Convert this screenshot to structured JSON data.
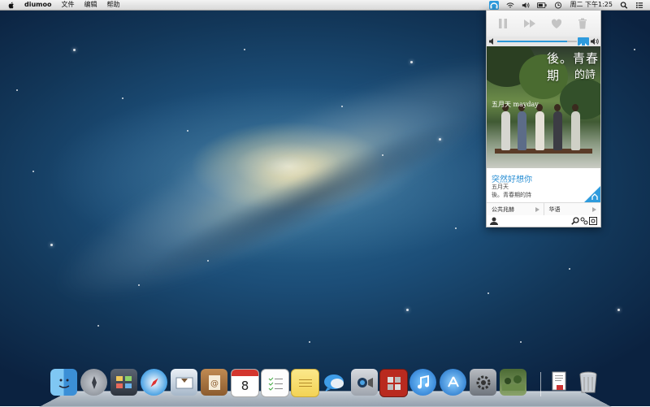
{
  "menubar": {
    "app_name": "diumoo",
    "menus": [
      "文件",
      "编辑",
      "帮助"
    ],
    "clock": "周二 下午1:25",
    "status_icons": [
      "diumoo-headphones-icon",
      "wifi-icon",
      "volume-icon",
      "battery-icon",
      "clock-icon",
      "spotlight-icon",
      "notification-list-icon"
    ]
  },
  "player": {
    "song_title": "突然好想你",
    "artist": "五月天",
    "album": "後。青春期的詩",
    "cover_art_text": [
      "後。青春期",
      "的詩",
      "五月天 mayday"
    ],
    "volume_level": 0.88,
    "channels": [
      "公共兆赫",
      "华语"
    ],
    "controls": [
      "pause-icon",
      "skip-icon",
      "heart-icon",
      "trash-icon"
    ],
    "bottom_icons": [
      "user-icon",
      "search-icon",
      "share-icon",
      "preferences-icon"
    ]
  },
  "dock": {
    "items": [
      "finder-icon",
      "launchpad-icon",
      "mission-control-icon",
      "safari-icon",
      "mail-icon",
      "contacts-icon",
      "calendar-icon",
      "reminders-icon",
      "notes-icon",
      "messages-icon",
      "facetime-icon",
      "photo-booth-icon",
      "itunes-icon",
      "app-store-icon",
      "system-preferences-icon",
      "photo-stack-icon",
      "documents-stack-icon",
      "trash-icon"
    ],
    "calendar_day": "8"
  }
}
